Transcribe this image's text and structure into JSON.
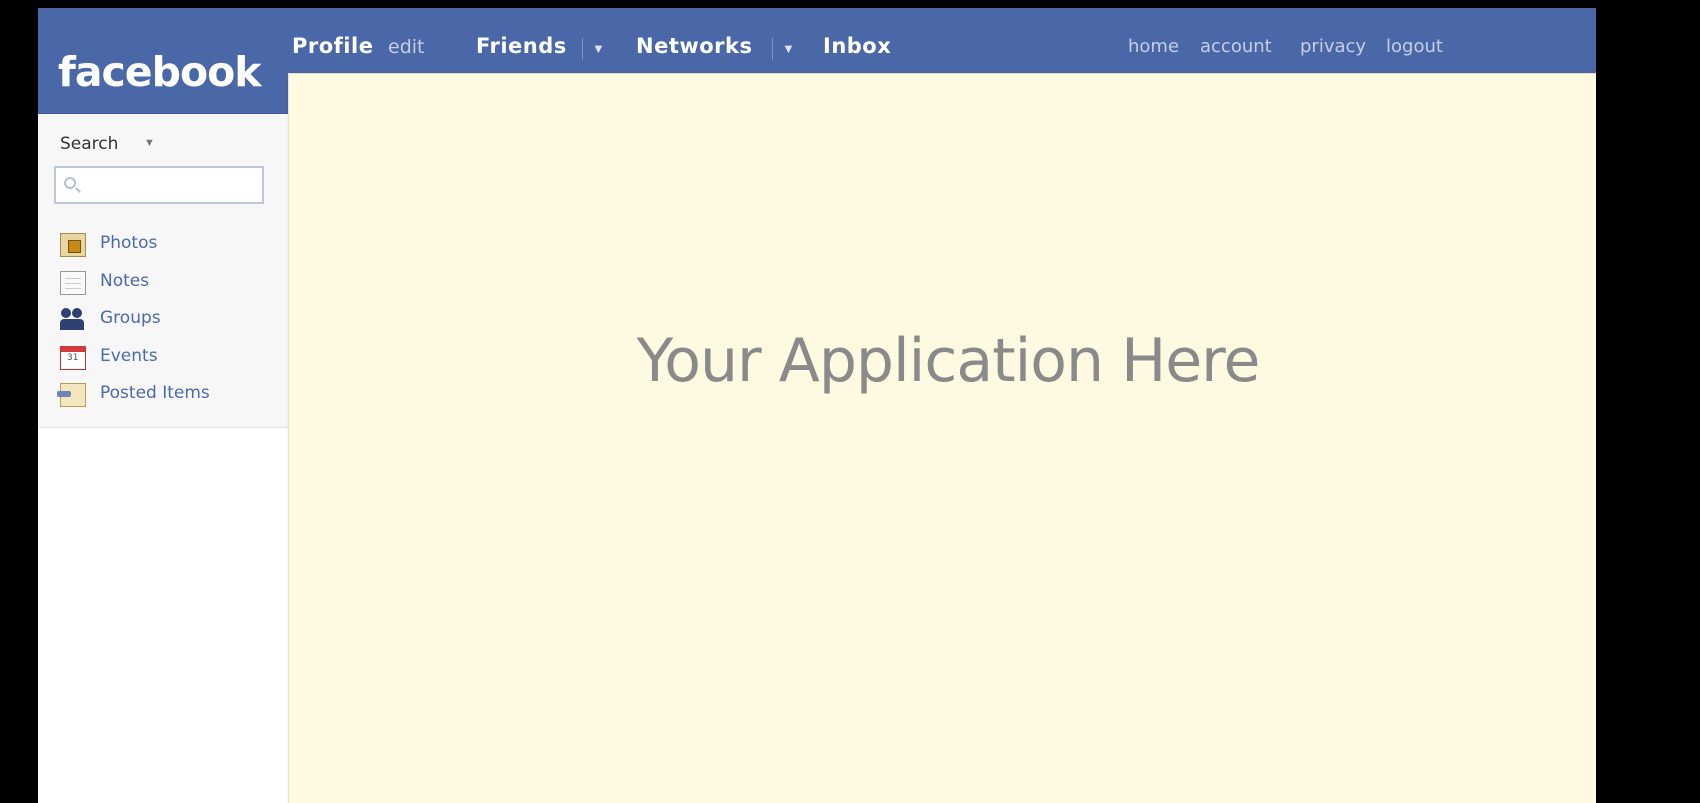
{
  "header": {
    "logo": "facebook",
    "nav": {
      "profile": "Profile",
      "edit": "edit",
      "friends": "Friends",
      "networks": "Networks",
      "inbox": "Inbox",
      "dropdown_glyph": "▼"
    },
    "links": {
      "home": "home",
      "account": "account",
      "privacy": "privacy",
      "logout": "logout"
    }
  },
  "sidebar": {
    "search_label": "Search",
    "search_caret": "▼",
    "search_placeholder": "",
    "items": [
      {
        "label": "Photos",
        "icon": "photos-icon"
      },
      {
        "label": "Notes",
        "icon": "notes-icon"
      },
      {
        "label": "Groups",
        "icon": "groups-icon"
      },
      {
        "label": "Events",
        "icon": "events-icon"
      },
      {
        "label": "Posted Items",
        "icon": "posted-items-icon"
      }
    ]
  },
  "main": {
    "placeholder_text": "Your Application Here"
  },
  "colors": {
    "topbar": "#4a68a8",
    "canvas": "#fef9e1",
    "link": "#4c6aa9"
  }
}
